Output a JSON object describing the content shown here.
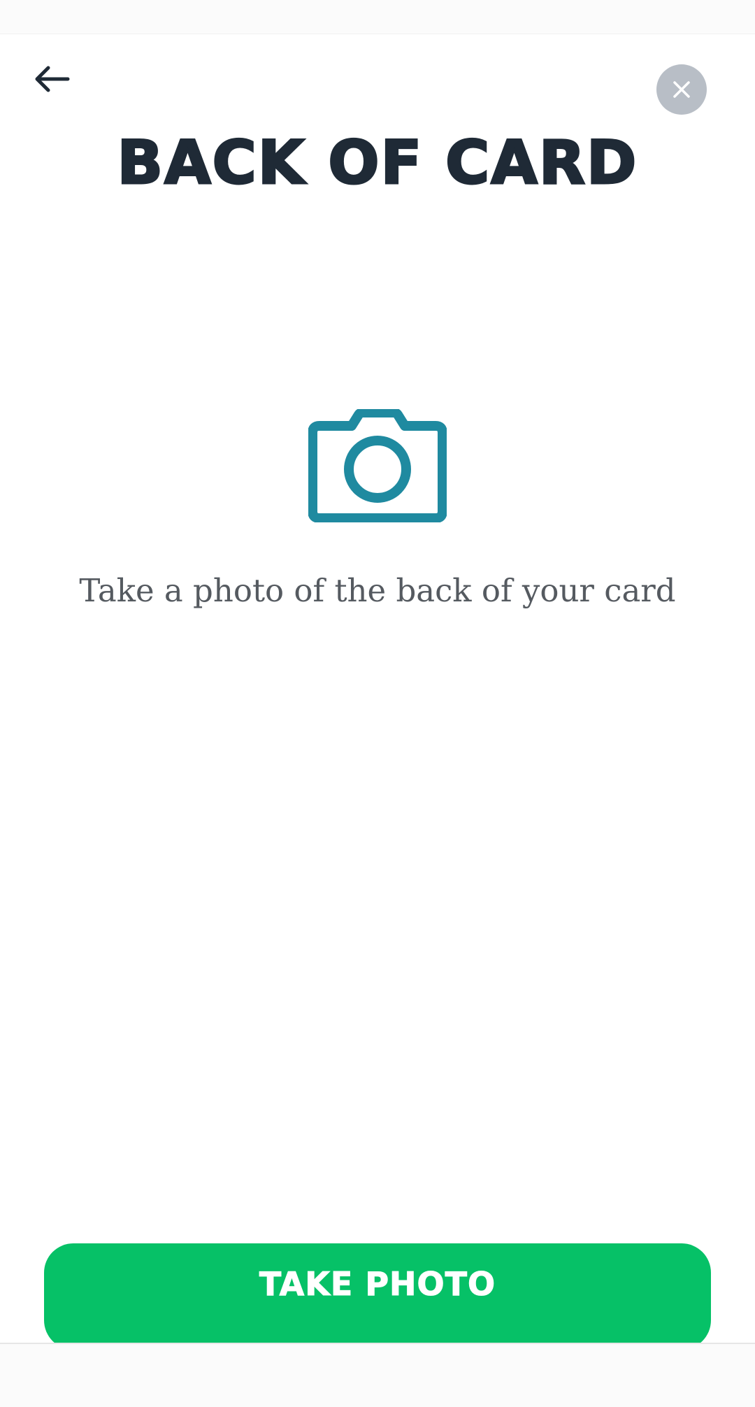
{
  "header": {
    "title": "BACK OF CARD",
    "back_icon": "arrow-left-icon",
    "close_icon": "close-icon",
    "close_button_color": "#b8bec6"
  },
  "main": {
    "icon": "camera-icon",
    "icon_color": "#1f8aa0",
    "instructions": "Take a photo of the back of your card"
  },
  "footer": {
    "take_photo_label": "TAKE PHOTO",
    "button_color": "#06c167"
  }
}
